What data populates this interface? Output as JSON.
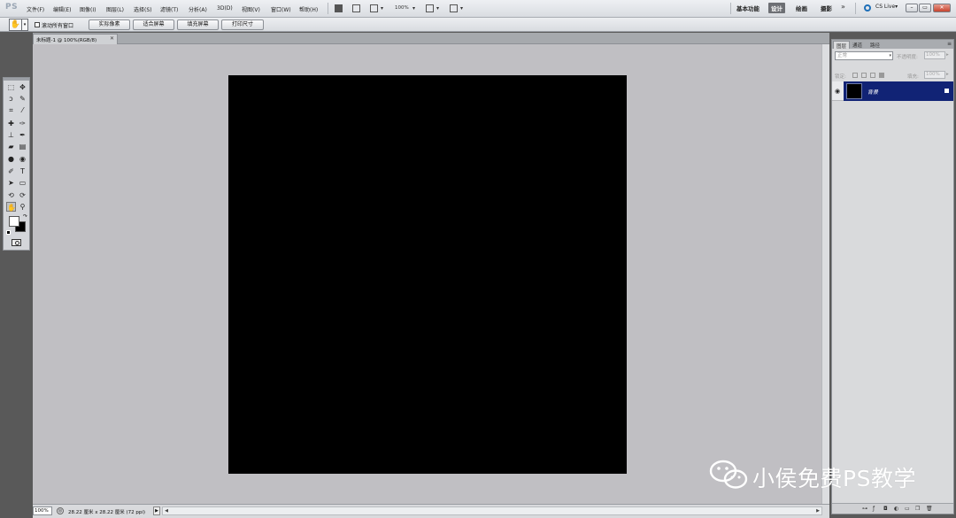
{
  "app": {
    "logo": "PS"
  },
  "menu": [
    "文件(F)",
    "编辑(E)",
    "图像(I)",
    "图层(L)",
    "选择(S)",
    "滤镜(T)",
    "分析(A)",
    "3D(D)",
    "视图(V)",
    "窗口(W)",
    "帮助(H)"
  ],
  "menubar": {
    "zoom": "100%"
  },
  "workspaces": {
    "basic": "基本功能",
    "design": "设计",
    "painting": "绘画",
    "photography": "摄影",
    "more": "»"
  },
  "cs_live": "CS Live▾",
  "window_controls": {
    "minimize": "–",
    "restore": "▭",
    "close": "✕"
  },
  "options": {
    "scroll_all_windows": "滚动所有窗口",
    "actual_pixels": "实际像素",
    "fit_screen": "适合屏幕",
    "fill_screen": "填充屏幕",
    "print_size": "打印尺寸"
  },
  "document": {
    "tab_title": "未标题-1 @ 100%(RGB/8)",
    "zoom": "100%",
    "info": "28.22 厘米 x 28.22 厘米 (72 ppi)"
  },
  "layers_panel": {
    "tabs": [
      "图层",
      "通道",
      "路径"
    ],
    "blend_mode": "正常",
    "opacity_label": "不透明度:",
    "opacity_value": "100%",
    "lock_label": "锁定:",
    "fill_label": "填充:",
    "fill_value": "100%",
    "layers": [
      {
        "name": "背景",
        "visible": true,
        "locked": true
      }
    ]
  },
  "watermark": {
    "text": "小侯免费PS教学"
  },
  "colors": {
    "canvas": "#000000",
    "pasteboard": "#c0bfc3",
    "layer_selected": "#112375",
    "foreground": "#ffffff",
    "background": "#000000"
  }
}
